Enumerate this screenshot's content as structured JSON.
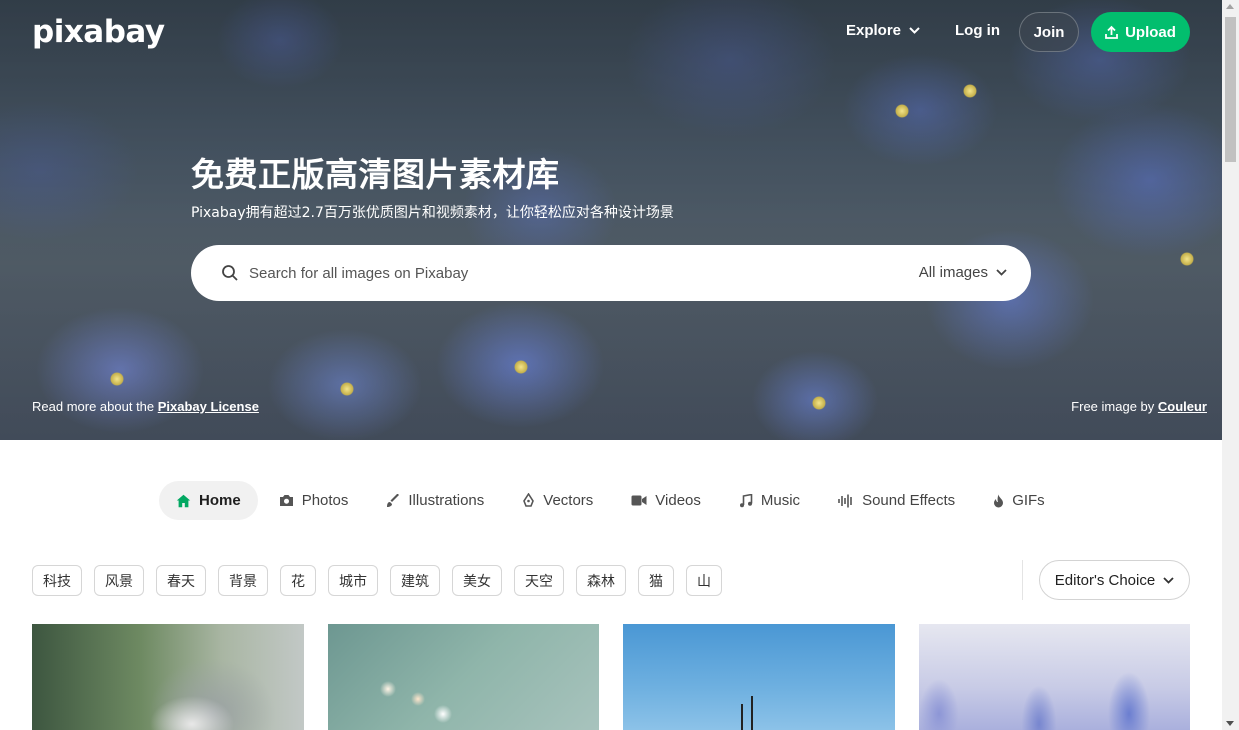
{
  "header": {
    "logo": "pixabay",
    "explore_label": "Explore",
    "login_label": "Log in",
    "join_label": "Join",
    "upload_label": "Upload"
  },
  "hero": {
    "title": "免费正版高清图片素材库",
    "subtitle": "Pixabay拥有超过2.7百万张优质图片和视频素材，让你轻松应对各种设计场景",
    "search_placeholder": "Search for all images on Pixabay",
    "search_type": "All images",
    "license_prefix": "Read more about the ",
    "license_link": "Pixabay License",
    "credit_prefix": "Free image by ",
    "credit_author": "Couleur"
  },
  "tabs": [
    {
      "label": "Home",
      "icon": "home-icon",
      "active": true
    },
    {
      "label": "Photos",
      "icon": "camera-icon"
    },
    {
      "label": "Illustrations",
      "icon": "brush-icon"
    },
    {
      "label": "Vectors",
      "icon": "pen-nib-icon"
    },
    {
      "label": "Videos",
      "icon": "video-camera-icon"
    },
    {
      "label": "Music",
      "icon": "music-note-icon"
    },
    {
      "label": "Sound Effects",
      "icon": "sound-wave-icon"
    },
    {
      "label": "GIFs",
      "icon": "flame-icon"
    }
  ],
  "tags": [
    "科技",
    "风景",
    "春天",
    "背景",
    "花",
    "城市",
    "建筑",
    "美女",
    "天空",
    "森林",
    "猫",
    "山"
  ],
  "sort": {
    "label": "Editor's Choice"
  },
  "colors": {
    "accent": "#02be6e",
    "join_bg": "#3c4650"
  }
}
